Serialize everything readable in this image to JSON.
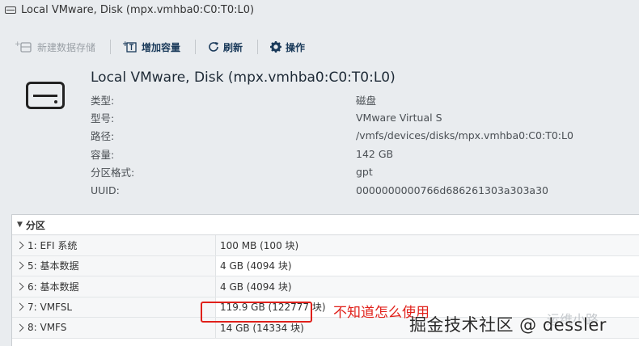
{
  "window": {
    "title": "Local VMware, Disk (mpx.vmhba0:C0:T0:L0)"
  },
  "toolbar": {
    "new_datastore": "新建数据存储",
    "increase_capacity": "增加容量",
    "refresh": "刷新",
    "actions": "操作"
  },
  "disk": {
    "name": "Local VMware, Disk (mpx.vmhba0:C0:T0:L0)",
    "properties": [
      {
        "key": "类型:",
        "value": "磁盘"
      },
      {
        "key": "型号:",
        "value": "VMware Virtual S"
      },
      {
        "key": "路径:",
        "value": "/vmfs/devices/disks/mpx.vmhba0:C0:T0:L0"
      },
      {
        "key": "容量:",
        "value": "142 GB"
      },
      {
        "key": "分区格式:",
        "value": "gpt"
      },
      {
        "key": "UUID:",
        "value": "0000000000766d686261303a303a30"
      }
    ]
  },
  "partitions": {
    "title": "分区",
    "rows": [
      {
        "name": "1: EFI 系统",
        "size": "100 MB (100 块)"
      },
      {
        "name": "5: 基本数据",
        "size": "4 GB (4094 块)"
      },
      {
        "name": "6: 基本数据",
        "size": "4 GB (4094 块)"
      },
      {
        "name": "7: VMFSL",
        "size": "119.9 GB (122777 块)"
      },
      {
        "name": "8: VMFS",
        "size": "14 GB (14334 块)"
      }
    ]
  },
  "annotation": "不知道怎么使用",
  "watermark": "掘金技术社区 @ dessler",
  "watermark_faint": "运维小路",
  "colors": {
    "accent": "#1a3a5a",
    "annotation": "#e0201a",
    "background": "#e9ecef"
  }
}
